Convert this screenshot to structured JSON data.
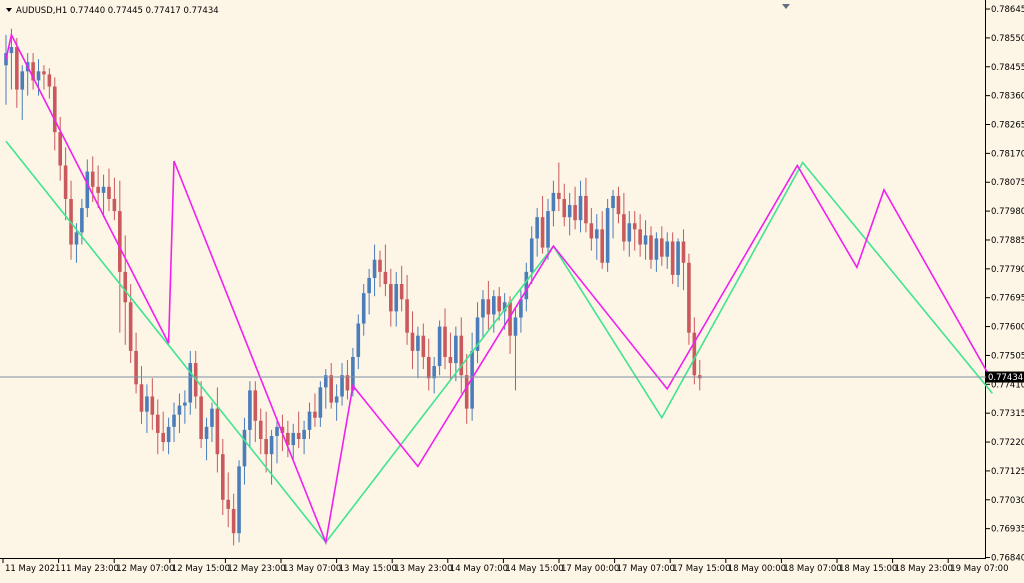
{
  "symbol_header": "AUDUSD,H1  0.77440 0.77445 0.77417 0.77434",
  "current_price_label": "0.77434",
  "current_price": 0.77434,
  "colors": {
    "background": "#FDF5E6",
    "bull_candle": "#4A7DBA",
    "bear_candle": "#C9595C",
    "zigzag_major": "#3FE58F",
    "zigzag_minor": "#F020F0",
    "price_line": "#8094A6"
  },
  "chart_data": {
    "type": "candlestick",
    "symbol": "AUDUSD",
    "timeframe": "H1",
    "ylim": [
      0.76845,
      0.78655
    ],
    "y_ticks": [
      "0.78645",
      "0.78550",
      "0.78455",
      "0.78360",
      "0.78265",
      "0.78170",
      "0.78075",
      "0.77980",
      "0.77885",
      "0.77790",
      "0.77695",
      "0.77600",
      "0.77505",
      "0.77410",
      "0.77315",
      "0.77220",
      "0.77125",
      "0.77030",
      "0.76935",
      "0.76840"
    ],
    "x_ticks": [
      "11 May 2021",
      "11 May 23:00",
      "12 May 07:00",
      "12 May 15:00",
      "12 May 23:00",
      "13 May 07:00",
      "13 May 15:00",
      "13 May 23:00",
      "14 May 07:00",
      "14 May 15:00",
      "17 May 00:00",
      "17 May 07:00",
      "17 May 15:00",
      "18 May 00:00",
      "18 May 07:00",
      "18 May 15:00",
      "18 May 23:00",
      "19 May 07:00"
    ],
    "candles": [
      [
        0.7846,
        0.7856,
        0.7833,
        0.785
      ],
      [
        0.785,
        0.7858,
        0.7838,
        0.7852
      ],
      [
        0.7852,
        0.7855,
        0.7832,
        0.7838
      ],
      [
        0.7838,
        0.7846,
        0.7828,
        0.7844
      ],
      [
        0.7844,
        0.785,
        0.7836,
        0.7847
      ],
      [
        0.7847,
        0.785,
        0.7838,
        0.7841
      ],
      [
        0.7841,
        0.7848,
        0.7836,
        0.7844
      ],
      [
        0.7844,
        0.7846,
        0.7838,
        0.7843
      ],
      [
        0.7843,
        0.7845,
        0.7835,
        0.7839
      ],
      [
        0.7839,
        0.7842,
        0.7818,
        0.7824
      ],
      [
        0.7824,
        0.7829,
        0.7808,
        0.7813
      ],
      [
        0.7813,
        0.7819,
        0.7795,
        0.7802
      ],
      [
        0.7802,
        0.7808,
        0.7782,
        0.7787
      ],
      [
        0.7787,
        0.7794,
        0.7781,
        0.7791
      ],
      [
        0.7791,
        0.7802,
        0.7787,
        0.7799
      ],
      [
        0.7799,
        0.7815,
        0.7796,
        0.7811
      ],
      [
        0.7811,
        0.7816,
        0.7801,
        0.7806
      ],
      [
        0.7806,
        0.7813,
        0.7799,
        0.7804
      ],
      [
        0.7804,
        0.781,
        0.7796,
        0.7806
      ],
      [
        0.7806,
        0.7812,
        0.7798,
        0.7802
      ],
      [
        0.7802,
        0.7809,
        0.7795,
        0.7798
      ],
      [
        0.7798,
        0.7808,
        0.7758,
        0.7778
      ],
      [
        0.7778,
        0.779,
        0.7754,
        0.7768
      ],
      [
        0.7768,
        0.7774,
        0.7748,
        0.7752
      ],
      [
        0.7752,
        0.7758,
        0.7738,
        0.7741
      ],
      [
        0.7741,
        0.7747,
        0.7728,
        0.7732
      ],
      [
        0.7732,
        0.7741,
        0.7725,
        0.7737
      ],
      [
        0.7737,
        0.7743,
        0.7726,
        0.7731
      ],
      [
        0.7731,
        0.7736,
        0.7718,
        0.7725
      ],
      [
        0.7725,
        0.7732,
        0.7719,
        0.7722
      ],
      [
        0.7722,
        0.773,
        0.7718,
        0.7727
      ],
      [
        0.7727,
        0.7735,
        0.7722,
        0.7731
      ],
      [
        0.7731,
        0.7738,
        0.7725,
        0.7734
      ],
      [
        0.7734,
        0.7739,
        0.7728,
        0.7735
      ],
      [
        0.7735,
        0.7752,
        0.7731,
        0.7748
      ],
      [
        0.7748,
        0.7752,
        0.7733,
        0.7737
      ],
      [
        0.7737,
        0.7742,
        0.772,
        0.7723
      ],
      [
        0.7723,
        0.773,
        0.7716,
        0.7727
      ],
      [
        0.7727,
        0.7735,
        0.7722,
        0.7733
      ],
      [
        0.7733,
        0.774,
        0.7712,
        0.7718
      ],
      [
        0.7718,
        0.7723,
        0.7698,
        0.7703
      ],
      [
        0.7703,
        0.7712,
        0.7694,
        0.77
      ],
      [
        0.77,
        0.7705,
        0.7688,
        0.7692
      ],
      [
        0.7692,
        0.7716,
        0.7689,
        0.7714
      ],
      [
        0.7714,
        0.773,
        0.7708,
        0.7726
      ],
      [
        0.7726,
        0.7742,
        0.772,
        0.7739
      ],
      [
        0.7739,
        0.7742,
        0.7722,
        0.7729
      ],
      [
        0.7729,
        0.7733,
        0.7718,
        0.7723
      ],
      [
        0.7723,
        0.7732,
        0.7712,
        0.7718
      ],
      [
        0.7718,
        0.7726,
        0.7708,
        0.7724
      ],
      [
        0.7724,
        0.773,
        0.7715,
        0.7727
      ],
      [
        0.7727,
        0.7731,
        0.7719,
        0.7725
      ],
      [
        0.7725,
        0.7729,
        0.7717,
        0.7721
      ],
      [
        0.7721,
        0.7728,
        0.7716,
        0.7725
      ],
      [
        0.7725,
        0.7732,
        0.772,
        0.7723
      ],
      [
        0.7723,
        0.7729,
        0.7718,
        0.7726
      ],
      [
        0.7726,
        0.7735,
        0.7723,
        0.7732
      ],
      [
        0.7732,
        0.7738,
        0.7727,
        0.773
      ],
      [
        0.773,
        0.7742,
        0.7727,
        0.774
      ],
      [
        0.774,
        0.7746,
        0.7733,
        0.7744
      ],
      [
        0.7744,
        0.7748,
        0.7733,
        0.7735
      ],
      [
        0.7735,
        0.7741,
        0.7729,
        0.7737
      ],
      [
        0.7737,
        0.7748,
        0.7734,
        0.7744
      ],
      [
        0.7744,
        0.7749,
        0.7736,
        0.7739
      ],
      [
        0.7739,
        0.7753,
        0.7737,
        0.775
      ],
      [
        0.775,
        0.7764,
        0.7746,
        0.7761
      ],
      [
        0.7761,
        0.7774,
        0.7757,
        0.7771
      ],
      [
        0.7771,
        0.7779,
        0.7764,
        0.7776
      ],
      [
        0.7776,
        0.7787,
        0.777,
        0.7782
      ],
      [
        0.7782,
        0.7785,
        0.7773,
        0.7778
      ],
      [
        0.7778,
        0.7787,
        0.777,
        0.7774
      ],
      [
        0.7774,
        0.7779,
        0.776,
        0.7765
      ],
      [
        0.7765,
        0.7778,
        0.776,
        0.7774
      ],
      [
        0.7774,
        0.778,
        0.7765,
        0.7769
      ],
      [
        0.7769,
        0.7777,
        0.7754,
        0.7758
      ],
      [
        0.7758,
        0.7765,
        0.7746,
        0.7752
      ],
      [
        0.7752,
        0.776,
        0.7743,
        0.7757
      ],
      [
        0.7757,
        0.7761,
        0.7746,
        0.775
      ],
      [
        0.775,
        0.7756,
        0.7739,
        0.7743
      ],
      [
        0.7743,
        0.775,
        0.7738,
        0.7747
      ],
      [
        0.7747,
        0.7762,
        0.7744,
        0.776
      ],
      [
        0.776,
        0.7766,
        0.7746,
        0.775
      ],
      [
        0.775,
        0.7758,
        0.7742,
        0.7748
      ],
      [
        0.7748,
        0.776,
        0.7742,
        0.7757
      ],
      [
        0.7757,
        0.7763,
        0.7738,
        0.7744
      ],
      [
        0.7744,
        0.7751,
        0.7728,
        0.7733
      ],
      [
        0.7733,
        0.7758,
        0.7729,
        0.7752
      ],
      [
        0.7752,
        0.7768,
        0.7748,
        0.7763
      ],
      [
        0.7763,
        0.7772,
        0.7756,
        0.7769
      ],
      [
        0.7769,
        0.7775,
        0.7759,
        0.7764
      ],
      [
        0.7764,
        0.7772,
        0.7758,
        0.777
      ],
      [
        0.777,
        0.7773,
        0.7762,
        0.7765
      ],
      [
        0.7765,
        0.7771,
        0.7759,
        0.7768
      ],
      [
        0.7768,
        0.777,
        0.7751,
        0.7757
      ],
      [
        0.7757,
        0.7766,
        0.7739,
        0.7763
      ],
      [
        0.7763,
        0.7772,
        0.7758,
        0.7769
      ],
      [
        0.7769,
        0.7781,
        0.7765,
        0.7778
      ],
      [
        0.7778,
        0.7793,
        0.7774,
        0.7789
      ],
      [
        0.7789,
        0.7799,
        0.7783,
        0.7796
      ],
      [
        0.7796,
        0.7803,
        0.7784,
        0.7786
      ],
      [
        0.7786,
        0.7802,
        0.7782,
        0.7798
      ],
      [
        0.7798,
        0.7808,
        0.7793,
        0.7804
      ],
      [
        0.7804,
        0.7814,
        0.7798,
        0.7802
      ],
      [
        0.7802,
        0.7807,
        0.7793,
        0.7796
      ],
      [
        0.7796,
        0.7804,
        0.779,
        0.78
      ],
      [
        0.78,
        0.7806,
        0.7792,
        0.7795
      ],
      [
        0.7795,
        0.7808,
        0.7791,
        0.7803
      ],
      [
        0.7803,
        0.7809,
        0.7791,
        0.7794
      ],
      [
        0.7794,
        0.7799,
        0.7785,
        0.7789
      ],
      [
        0.7789,
        0.7797,
        0.7782,
        0.7792
      ],
      [
        0.7792,
        0.7798,
        0.7779,
        0.7781
      ],
      [
        0.7781,
        0.7802,
        0.7778,
        0.7799
      ],
      [
        0.7799,
        0.7805,
        0.7789,
        0.7803
      ],
      [
        0.7803,
        0.7806,
        0.7794,
        0.7797
      ],
      [
        0.7797,
        0.7804,
        0.7785,
        0.7788
      ],
      [
        0.7788,
        0.7798,
        0.7783,
        0.7794
      ],
      [
        0.7794,
        0.7798,
        0.7785,
        0.7792
      ],
      [
        0.7792,
        0.7797,
        0.7783,
        0.7787
      ],
      [
        0.7787,
        0.7795,
        0.7782,
        0.779
      ],
      [
        0.779,
        0.7793,
        0.7779,
        0.7782
      ],
      [
        0.7782,
        0.7791,
        0.7778,
        0.7789
      ],
      [
        0.7789,
        0.7793,
        0.778,
        0.7783
      ],
      [
        0.7783,
        0.7791,
        0.7779,
        0.7788
      ],
      [
        0.7788,
        0.7791,
        0.7774,
        0.7777
      ],
      [
        0.7777,
        0.7789,
        0.7773,
        0.7788
      ],
      [
        0.7788,
        0.7792,
        0.7772,
        0.7781
      ],
      [
        0.7781,
        0.7784,
        0.7754,
        0.7758
      ],
      [
        0.7758,
        0.7763,
        0.7741,
        0.7744
      ],
      [
        0.7744,
        0.7749,
        0.7739,
        0.7743
      ]
    ],
    "zigzag_major": [
      [
        0,
        0.7821
      ],
      [
        59,
        0.7689
      ],
      [
        101,
        0.77865
      ],
      [
        121,
        0.773
      ],
      [
        147,
        0.7814
      ],
      [
        182,
        0.7738
      ]
    ],
    "zigzag_minor": [
      [
        0,
        0.7848
      ],
      [
        1,
        0.7856
      ],
      [
        30,
        0.77545
      ],
      [
        31,
        0.78145
      ],
      [
        59,
        0.7689
      ],
      [
        64,
        0.77405
      ],
      [
        76,
        0.7714
      ],
      [
        101,
        0.77865
      ],
      [
        122,
        0.77395
      ],
      [
        146,
        0.7813
      ],
      [
        157,
        0.77795
      ],
      [
        162,
        0.7805
      ],
      [
        182,
        0.7742
      ]
    ]
  }
}
